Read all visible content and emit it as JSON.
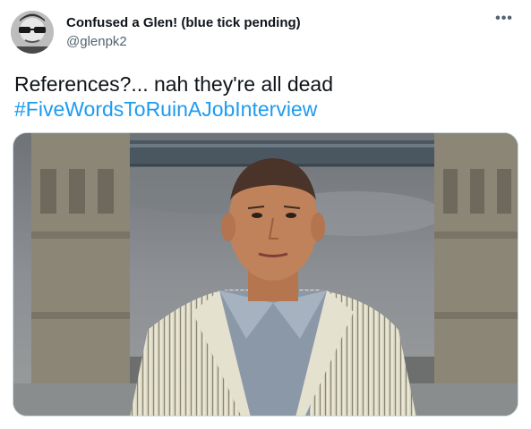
{
  "tweet": {
    "display_name": "Confused a Glen! (blue tick pending)",
    "handle": "@glenpk2",
    "more_icon": "more-horizontal-icon",
    "text_line1": "References?...  nah they're all dead",
    "hashtag": "#FiveWordsToRuinAJobInterview",
    "hashtag_color": "#1d9bf0",
    "media_alt": "photo of a man in a white striped suit in front of Tower Bridge"
  }
}
